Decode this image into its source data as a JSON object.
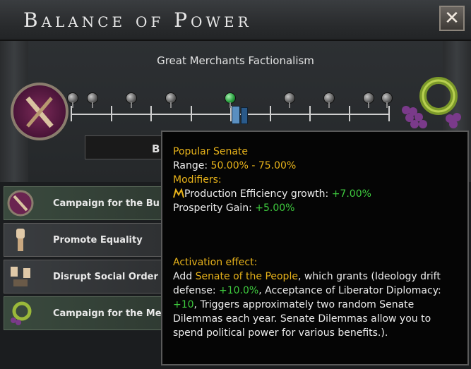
{
  "window": {
    "title": "Balance of Power",
    "close_glyph": "✕"
  },
  "balance": {
    "name": "Great Merchants Factionalism",
    "slot_text": "B",
    "colors": {
      "active_pin": "#2aa040",
      "inactive_pin": "#5a5a5a",
      "marker": "#5a8fc0"
    }
  },
  "actions": [
    {
      "label": "Campaign for the Bu",
      "icon": "faction-shield-icon",
      "selected": true
    },
    {
      "label": "Promote Equality",
      "icon": "raised-fist-icon",
      "selected": false
    },
    {
      "label": "Disrupt Social Order",
      "icon": "broken-chains-icon",
      "selected": false
    },
    {
      "label": "Campaign for the Me",
      "icon": "grape-wreath-icon",
      "selected": true
    }
  ],
  "tooltip": {
    "heading": "Popular Senate",
    "range_label": "Range: ",
    "range_value": "50.00% - 75.00%",
    "modifiers_label": "Modifiers:",
    "mod1_label": "Production Efficiency growth: ",
    "mod1_value": "+7.00%",
    "mod2_label": "Prosperity Gain: ",
    "mod2_value": "+5.00%",
    "activation_label": "Activation effect:",
    "act_prefix": "Add ",
    "act_name": "Senate of the People",
    "act_mid1": ", which grants (Ideology drift defense: ",
    "act_val1": "+10.0%",
    "act_mid2": ", Acceptance of Liberator Diplomacy: ",
    "act_val2": "+10",
    "act_rest": ", Triggers approximately two random Senate Dilemmas each year. Senate Dilemmas allow you to spend political power for various benefits.)."
  }
}
